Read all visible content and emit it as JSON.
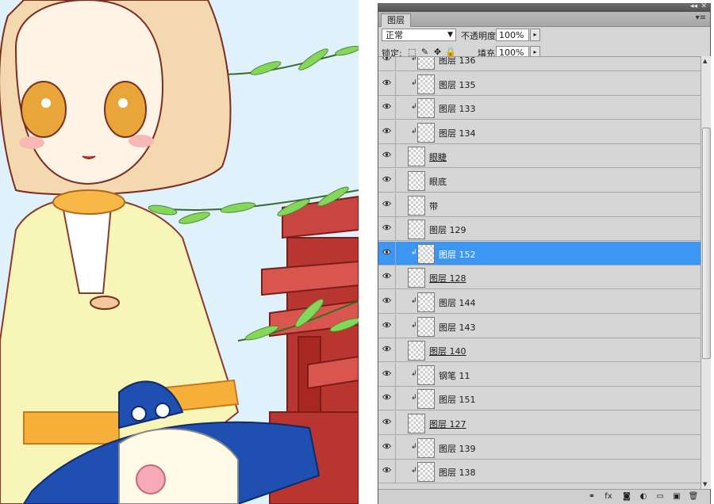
{
  "panel": {
    "tab_label": "图层",
    "blend_mode": "正常",
    "opacity_label": "不透明度:",
    "opacity_value": "100%",
    "lock_label": "锁定:",
    "fill_label": "填充:",
    "fill_value": "100%"
  },
  "layers": [
    {
      "name": "图层 136",
      "clipped": true,
      "underline": false,
      "selected": false
    },
    {
      "name": "图层 135",
      "clipped": true,
      "underline": false,
      "selected": false
    },
    {
      "name": "图层 133",
      "clipped": true,
      "underline": false,
      "selected": false
    },
    {
      "name": "图层 134",
      "clipped": true,
      "underline": false,
      "selected": false
    },
    {
      "name": "眼睫",
      "clipped": false,
      "underline": true,
      "selected": false
    },
    {
      "name": "眼底",
      "clipped": false,
      "underline": false,
      "selected": false
    },
    {
      "name": "带",
      "clipped": false,
      "underline": false,
      "selected": false
    },
    {
      "name": "图层 129",
      "clipped": false,
      "underline": false,
      "selected": false
    },
    {
      "name": "图层 152",
      "clipped": true,
      "underline": false,
      "selected": true
    },
    {
      "name": "图层 128",
      "clipped": false,
      "underline": true,
      "selected": false
    },
    {
      "name": "图层 144",
      "clipped": true,
      "underline": false,
      "selected": false
    },
    {
      "name": "图层 143",
      "clipped": true,
      "underline": false,
      "selected": false
    },
    {
      "name": "图层 140",
      "clipped": false,
      "underline": true,
      "selected": false
    },
    {
      "name": "钢笔 11",
      "clipped": true,
      "underline": false,
      "selected": false
    },
    {
      "name": "图层 151",
      "clipped": true,
      "underline": false,
      "selected": false
    },
    {
      "name": "图层 127",
      "clipped": false,
      "underline": true,
      "selected": false
    },
    {
      "name": "图层 139",
      "clipped": true,
      "underline": false,
      "selected": false
    },
    {
      "name": "图层 138",
      "clipped": true,
      "underline": false,
      "selected": false
    }
  ],
  "bottom_tools": [
    {
      "icon": "link-layers-icon",
      "glyph": "⚭"
    },
    {
      "icon": "layer-style-fx-icon",
      "glyph": "fx"
    },
    {
      "icon": "add-mask-icon",
      "glyph": "◙"
    },
    {
      "icon": "adjustment-layer-icon",
      "glyph": "◐"
    },
    {
      "icon": "new-group-icon",
      "glyph": "▭"
    },
    {
      "icon": "new-layer-icon",
      "glyph": "▣"
    },
    {
      "icon": "delete-layer-icon",
      "glyph": "🗑"
    }
  ],
  "colors": {
    "selection": "#3b97f3",
    "panel_bg": "#d6d6d6",
    "canvas_sky": "#dff1fa"
  }
}
